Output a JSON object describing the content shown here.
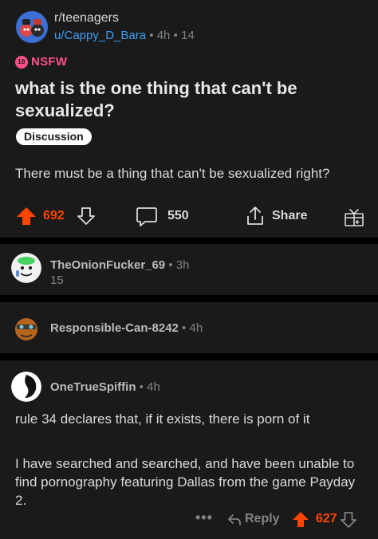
{
  "post": {
    "subreddit": "r/teenagers",
    "author": "u/Cappy_D_Bara",
    "age": "4h",
    "sep": "•",
    "other": "14",
    "nsfw_badge": "18",
    "nsfw_label": "NSFW",
    "title": "what is the one thing that can't be sexualized?",
    "flair": "Discussion",
    "body": "There must be a thing that can't be sexualized right?",
    "score": "692",
    "comments": "550",
    "share_label": "Share"
  },
  "comments": [
    {
      "author": "TheOnionFucker_69",
      "time": " • 3h",
      "score": "15"
    },
    {
      "author": "Responsible-Can-8242",
      "time": " • 4h"
    },
    {
      "author": "OneTrueSpiffin",
      "time": " • 4h",
      "paragraph_1": "rule 34 declares that, if it exists, there is porn of it",
      "paragraph_2": "I have searched and searched, and have been unable to find pornography featuring Dallas from the game Payday 2.",
      "more": "•••",
      "reply_label": "Reply",
      "score": "627"
    }
  ],
  "colors": {
    "background": "#000000",
    "card": "#1a1a1b",
    "upvote": "#ff4500",
    "nsfw": "#ff4f8b",
    "link": "#3d9df5",
    "muted": "#818384"
  },
  "icons": [
    "subreddit-avatar",
    "nsfw-icon",
    "upvote-icon",
    "downvote-icon",
    "comment-icon",
    "share-icon",
    "award-icon",
    "user-avatar",
    "reply-icon",
    "more-icon"
  ]
}
